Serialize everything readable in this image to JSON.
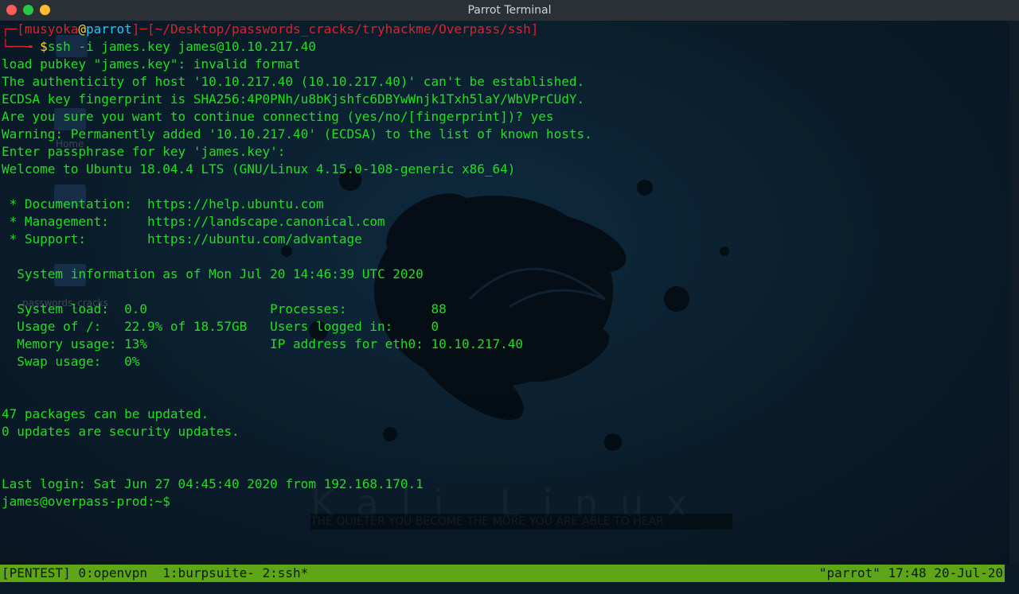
{
  "window": {
    "title": "Parrot Terminal"
  },
  "desktop": {
    "labels": [
      "Home",
      "passwords_cracks"
    ]
  },
  "wallpaper": {
    "brand": "Kali Linux",
    "motto": "THE QUIETER YOU BECOME THE MORE YOU ARE ABLE TO HEAR"
  },
  "prompt": {
    "open": "┌─[",
    "user": "musyoka",
    "at": "@",
    "host": "parrot",
    "mid": "]─[",
    "path": "~/Desktop/passwords_cracks/tryhackme/Overpass/ssh",
    "close": "]",
    "corner": "└──╼ ",
    "dollar": "$",
    "command": "ssh -i james.key james@10.10.217.40"
  },
  "output": [
    "load pubkey \"james.key\": invalid format",
    "The authenticity of host '10.10.217.40 (10.10.217.40)' can't be established.",
    "ECDSA key fingerprint is SHA256:4P0PNh/u8bKjshfc6DBYwWnjk1Txh5laY/WbVPrCUdY.",
    "Are you sure you want to continue connecting (yes/no/[fingerprint])? yes",
    "Warning: Permanently added '10.10.217.40' (ECDSA) to the list of known hosts.",
    "Enter passphrase for key 'james.key':",
    "Welcome to Ubuntu 18.04.4 LTS (GNU/Linux 4.15.0-108-generic x86_64)",
    "",
    " * Documentation:  https://help.ubuntu.com",
    " * Management:     https://landscape.canonical.com",
    " * Support:        https://ubuntu.com/advantage",
    "",
    "  System information as of Mon Jul 20 14:46:39 UTC 2020",
    "",
    "  System load:  0.0                Processes:           88",
    "  Usage of /:   22.9% of 18.57GB   Users logged in:     0",
    "  Memory usage: 13%                IP address for eth0: 10.10.217.40",
    "  Swap usage:   0%",
    "",
    "",
    "47 packages can be updated.",
    "0 updates are security updates.",
    "",
    "",
    "Last login: Sat Jun 27 04:45:40 2020 from 192.168.170.1",
    "james@overpass-prod:~$"
  ],
  "tmux": {
    "left": "[PENTEST] 0:openvpn  1:burpsuite- 2:ssh*",
    "right": "\"parrot\" 17:48 20-Jul-20"
  }
}
